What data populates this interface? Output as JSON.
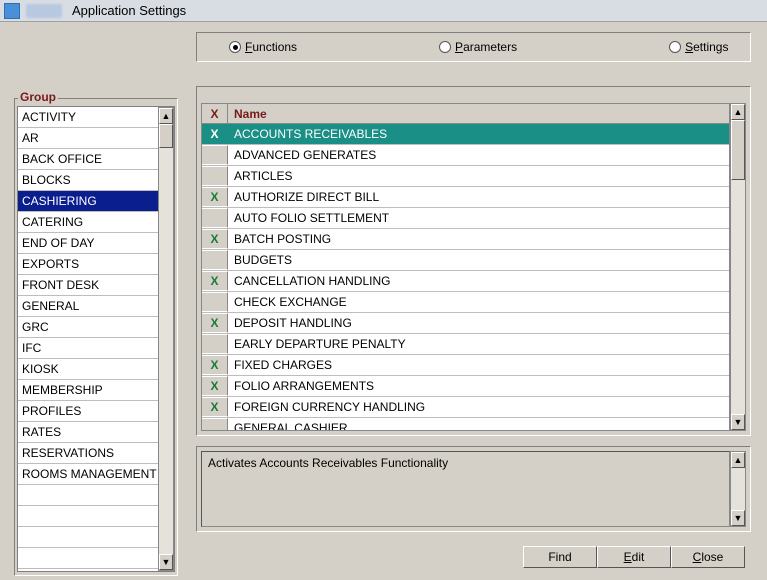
{
  "title": "Application Settings",
  "radios": {
    "functions": "Functions",
    "parameters": "Parameters",
    "settings": "Settings",
    "selected": "functions"
  },
  "group": {
    "label": "Group",
    "items": [
      "ACTIVITY",
      "AR",
      "BACK OFFICE",
      "BLOCKS",
      "CASHIERING",
      "CATERING",
      "END OF DAY",
      "EXPORTS",
      "FRONT DESK",
      "GENERAL",
      "GRC",
      "IFC",
      "KIOSK",
      "MEMBERSHIP",
      "PROFILES",
      "RATES",
      "RESERVATIONS",
      "ROOMS MANAGEMENT",
      "",
      "",
      "",
      ""
    ],
    "selected_index": 4
  },
  "name_table": {
    "col_x": "X",
    "col_name": "Name",
    "rows": [
      {
        "x": "X",
        "name": "ACCOUNTS RECEIVABLES",
        "selected": true
      },
      {
        "x": "",
        "name": "ADVANCED GENERATES"
      },
      {
        "x": "",
        "name": "ARTICLES"
      },
      {
        "x": "X",
        "name": "AUTHORIZE DIRECT BILL"
      },
      {
        "x": "",
        "name": "AUTO FOLIO SETTLEMENT"
      },
      {
        "x": "X",
        "name": "BATCH POSTING"
      },
      {
        "x": "",
        "name": "BUDGETS"
      },
      {
        "x": "X",
        "name": "CANCELLATION HANDLING"
      },
      {
        "x": "",
        "name": "CHECK EXCHANGE"
      },
      {
        "x": "X",
        "name": "DEPOSIT HANDLING"
      },
      {
        "x": "",
        "name": "EARLY DEPARTURE PENALTY"
      },
      {
        "x": "X",
        "name": "FIXED CHARGES"
      },
      {
        "x": "X",
        "name": "FOLIO ARRANGEMENTS"
      },
      {
        "x": "X",
        "name": "FOREIGN CURRENCY HANDLING"
      },
      {
        "x": "",
        "name": "GENERAL CASHIER"
      }
    ]
  },
  "description": "Activates Accounts Receivables Functionality",
  "buttons": {
    "find": "Find",
    "edit": "Edit",
    "close": "Close"
  }
}
